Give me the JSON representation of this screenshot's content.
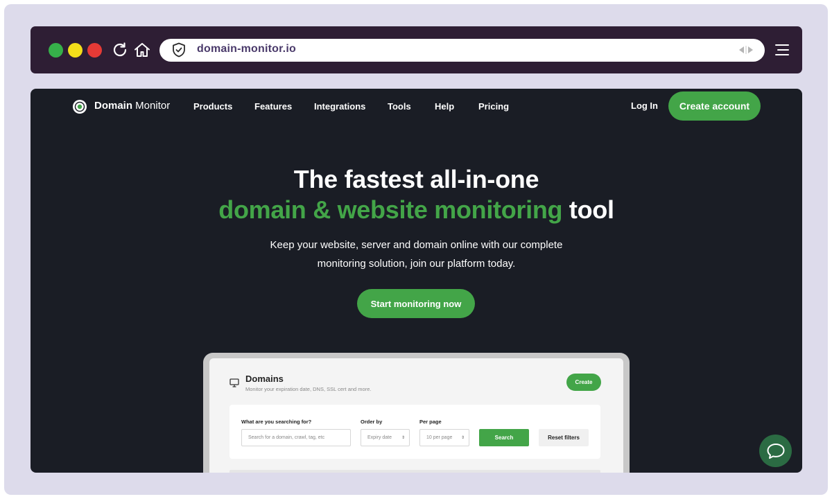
{
  "browser": {
    "url": "domain-monitor.io",
    "window_controls": [
      {
        "name": "maximize",
        "color": "#36b04a"
      },
      {
        "name": "minimize",
        "color": "#f3de1a"
      },
      {
        "name": "close",
        "color": "#e53a36"
      }
    ],
    "icons": [
      "reload-icon",
      "home-icon",
      "shield-check-icon",
      "back-forward-arrows-icon",
      "menu-icon"
    ]
  },
  "nav": {
    "brand_bold": "Domain",
    "brand_rest": " Monitor",
    "links": [
      "Products",
      "Features",
      "Integrations",
      "Tools",
      "Help",
      "Pricing"
    ],
    "login": "Log In",
    "create_account": "Create account"
  },
  "hero": {
    "title_line1": "The fastest all-in-one",
    "title_highlight": "domain & website monitoring",
    "title_tail": " tool",
    "subtitle_line1": "Keep your website, server and domain online with our complete",
    "subtitle_line2": "monitoring solution, join our platform today.",
    "cta": "Start monitoring now"
  },
  "mockup": {
    "title": "Domains",
    "subtitle": "Monitor your expiration date, DNS, SSL cert and more.",
    "create": "Create",
    "search_label": "What are you searching for?",
    "search_placeholder": "Search for a domain, crawl, tag, etc",
    "order_label": "Order by",
    "order_value": "Expiry date",
    "perpage_label": "Per page",
    "perpage_value": "10 per page",
    "search_button": "Search",
    "reset_button": "Reset filters"
  },
  "colors": {
    "accent": "#43a548",
    "page_bg": "#1a1d25",
    "chrome_bg": "#2e1e34",
    "frame_bg": "#dddbeb",
    "chat_bg": "#2b6b43"
  }
}
